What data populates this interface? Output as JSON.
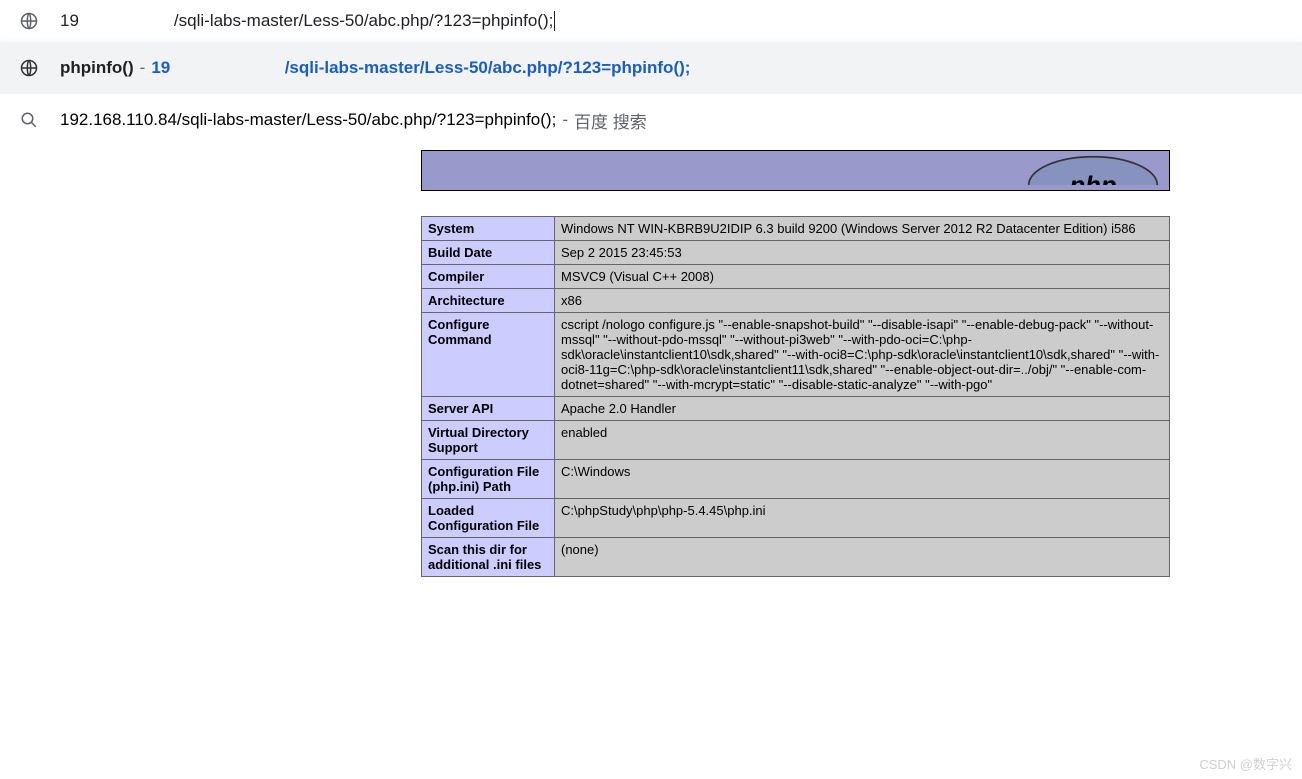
{
  "address_bar": {
    "prefix": "19",
    "suffix": "/sqli-labs-master/Less-50/abc.php/?123=phpinfo();"
  },
  "suggestions": [
    {
      "kind": "globe",
      "pre": "phpinfo()",
      "dash": " - ",
      "link_prefix": "19",
      "link_suffix": "/sqli-labs-master/Less-50/abc.php/?123=phpinfo();",
      "highlight": true
    },
    {
      "kind": "search",
      "text": "192.168.110.84/sqli-labs-master/Less-50/abc.php/?123=phpinfo();",
      "dash": " - ",
      "trail": "百度 搜索",
      "highlight": false
    }
  ],
  "phpinfo_rows": [
    {
      "key": "System",
      "val": "Windows NT WIN-KBRB9U2IDIP 6.3 build 9200 (Windows Server 2012 R2 Datacenter Edition) i586"
    },
    {
      "key": "Build Date",
      "val": "Sep 2 2015 23:45:53"
    },
    {
      "key": "Compiler",
      "val": "MSVC9 (Visual C++ 2008)"
    },
    {
      "key": "Architecture",
      "val": "x86"
    },
    {
      "key": "Configure Command",
      "val": "cscript /nologo configure.js \"--enable-snapshot-build\" \"--disable-isapi\" \"--enable-debug-pack\" \"--without-mssql\" \"--without-pdo-mssql\" \"--without-pi3web\" \"--with-pdo-oci=C:\\php-sdk\\oracle\\instantclient10\\sdk,shared\" \"--with-oci8=C:\\php-sdk\\oracle\\instantclient10\\sdk,shared\" \"--with-oci8-11g=C:\\php-sdk\\oracle\\instantclient11\\sdk,shared\" \"--enable-object-out-dir=../obj/\" \"--enable-com-dotnet=shared\" \"--with-mcrypt=static\" \"--disable-static-analyze\" \"--with-pgo\""
    },
    {
      "key": "Server API",
      "val": "Apache 2.0 Handler"
    },
    {
      "key": "Virtual Directory Support",
      "val": "enabled"
    },
    {
      "key": "Configuration File (php.ini) Path",
      "val": "C:\\Windows"
    },
    {
      "key": "Loaded Configuration File",
      "val": "C:\\phpStudy\\php\\php-5.4.45\\php.ini"
    },
    {
      "key": "Scan this dir for additional .ini files",
      "val": "(none)"
    }
  ],
  "watermark": "CSDN @数字兴"
}
